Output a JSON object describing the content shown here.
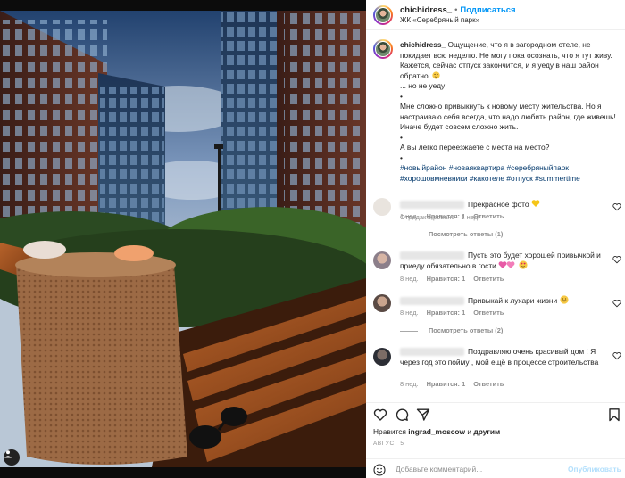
{
  "post": {
    "author": "chichidress_",
    "dot": "•",
    "follow_label": "Подписаться",
    "location": "ЖК «Серебряный парк»",
    "caption_lines": [
      "Ощущение, что я в загородном отеле, не покидает всю неделю. Не могу пока осознать, что я тут живу. Кажется, сейчас отпуск закончится, и я уеду в наш район обратно.",
      "... но не уеду",
      "•",
      "Мне сложно привыкнуть к новому месту жительства. Но я настраиваю себя всегда, что надо любить район, где живешь! Иначе будет совсем сложно жить.",
      "•",
      "А вы легко переезжаете с места на место?",
      "•"
    ],
    "hashtags": "#новыйрайон #новаяквартира #серебряныйпарк #хорошовмневники #какотеле #отпуск #summertime",
    "edited_label": "Отредактировано",
    "caption_age": "1 нед."
  },
  "comments": [
    {
      "text": "Прекрасное фото",
      "age": "1 нед.",
      "likes": "Нравится: 1",
      "reply": "Ответить",
      "replies_label": "Посмотреть ответы (1)"
    },
    {
      "text": "Пусть это будет хорошей привычкой  и приеду обязательно в гости ",
      "age": "8 нед.",
      "likes": "Нравится: 1",
      "reply": "Ответить",
      "replies_label": ""
    },
    {
      "text": "Привыкай к лухари жизни",
      "age": "8 нед.",
      "likes": "Нравится: 1",
      "reply": "Ответить",
      "replies_label": "Посмотреть ответы (2)"
    },
    {
      "text": "Поздравляю  очень красивый дом ! Я через год это пойму , мой ещё в процессе строительства ...",
      "age": "8 нед.",
      "likes": "Нравится: 1",
      "reply": "Ответить",
      "replies_label": ""
    }
  ],
  "likes_line": {
    "prefix": "Нравится",
    "user1": "ingrad_moscow",
    "middle": "и",
    "others": "другим"
  },
  "date": "АВГУСТ 5",
  "comment_box": {
    "placeholder": "Добавьте комментарий...",
    "publish_label": "Опубликовать"
  },
  "colors": {
    "accent": "#0095f6",
    "publish_disabled": "#b2dffc",
    "secondary_text": "#8e8e8e"
  },
  "icons": [
    "heart-icon",
    "comment-icon",
    "share-icon",
    "bookmark-icon",
    "emoji-icon",
    "user-tag-icon"
  ]
}
